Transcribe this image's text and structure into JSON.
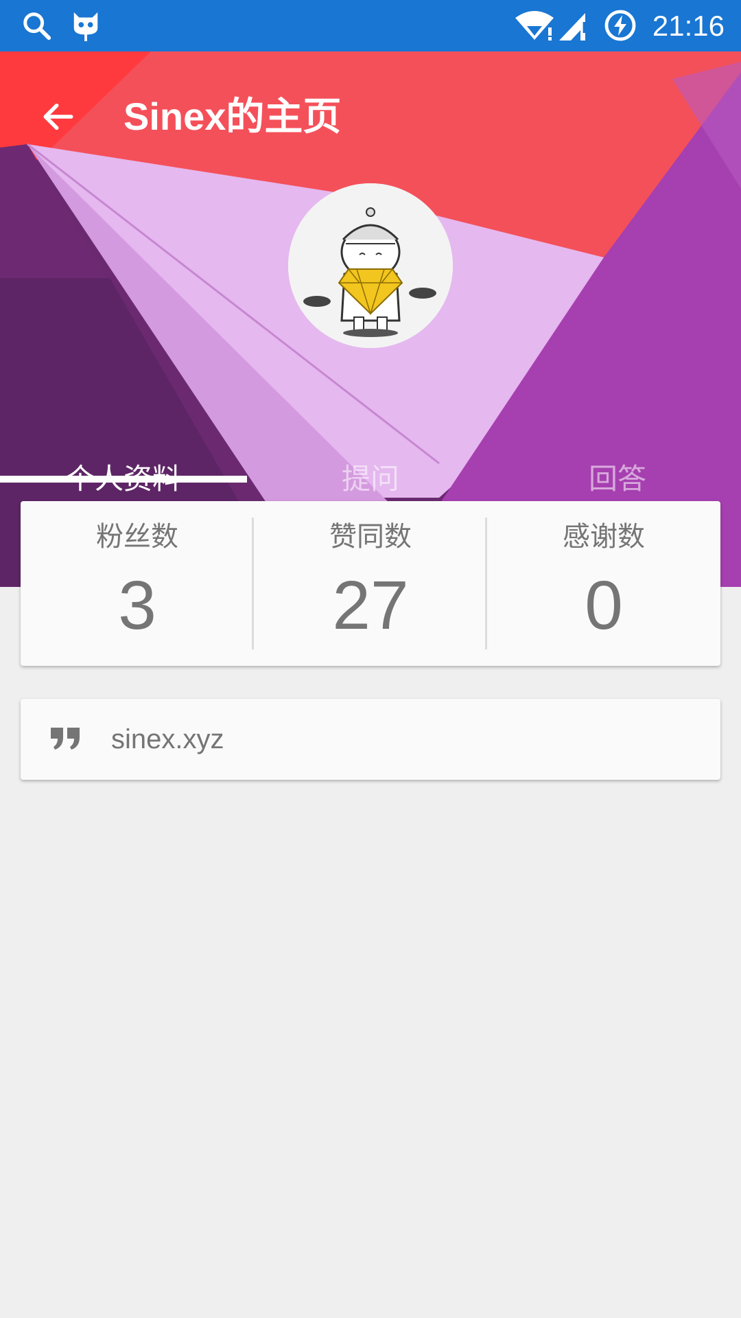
{
  "status_bar": {
    "time": "21:16",
    "icons": [
      "search-icon",
      "bot-icon",
      "wifi-icon",
      "signal-icon",
      "battery-charging-icon"
    ]
  },
  "header": {
    "title": "Sinex的主页",
    "back_icon": "arrow-left-icon",
    "avatar_icon": "avatar-illustration"
  },
  "tabs": [
    {
      "label": "个人资料",
      "active": true
    },
    {
      "label": "提问",
      "active": false
    },
    {
      "label": "回答",
      "active": false
    }
  ],
  "stats": [
    {
      "label": "粉丝数",
      "value": "3"
    },
    {
      "label": "赞同数",
      "value": "27"
    },
    {
      "label": "感谢数",
      "value": "0"
    }
  ],
  "bio": {
    "icon": "quote-icon",
    "text": "sinex.xyz"
  },
  "colors": {
    "status_bar": "#1976d2",
    "page_bg": "#efefef",
    "card_bg": "#fafafa",
    "text_secondary": "#757575"
  }
}
